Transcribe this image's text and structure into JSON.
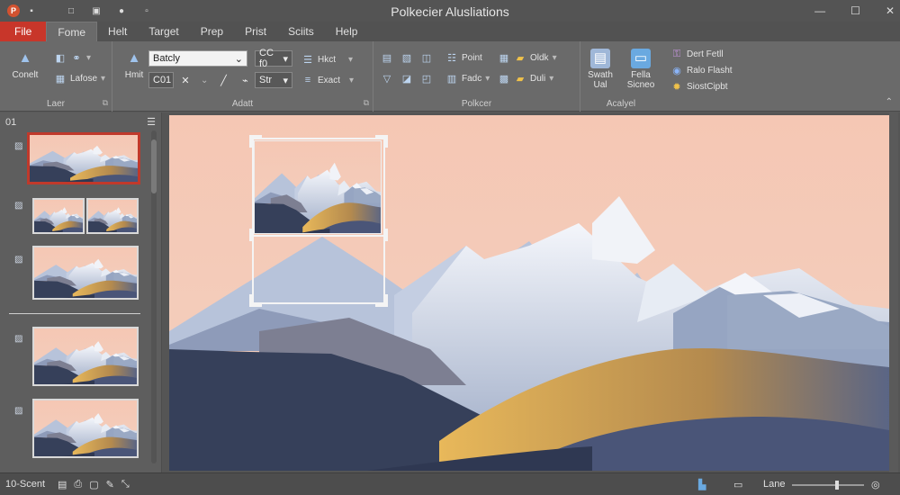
{
  "window": {
    "title": "Polkecier Alusliations"
  },
  "menu": {
    "tabs": [
      "File",
      "Fome",
      "Helt",
      "Target",
      "Prep",
      "Prist",
      "Sciits",
      "Help"
    ]
  },
  "ribbon": {
    "groups": [
      "Laer",
      "Adatt",
      "Polkcer",
      "Acalyel"
    ],
    "convert_label": "Conelt",
    "lafose_label": "Lafose",
    "hmit_label": "Hmit",
    "font_name": "Batcly",
    "font_size_small": "C01",
    "size_combo": "CC f0",
    "size_combo2": "Str",
    "hkct_label": "Hkct",
    "exact_label": "Exact",
    "point_label": "Point",
    "fadc_label": "Fadc",
    "oldk_label": "Oldk",
    "duli_label": "Duli",
    "swath_label": "Swath",
    "swath_sub": "Ual",
    "fella_label": "Fella",
    "sicneo_label": "Sicneo",
    "list1": "Dert Fetll",
    "list2": "Ralo Flasht",
    "list3": "SiostCipbt"
  },
  "thumbs": {
    "header": "01"
  },
  "status": {
    "slide_info": "10-Scent",
    "zoom_label": "Lane"
  },
  "colors": {
    "file_tab": "#c8362a",
    "accent": "#9fc3ec",
    "selected_thumb_border": "#c0392b"
  }
}
